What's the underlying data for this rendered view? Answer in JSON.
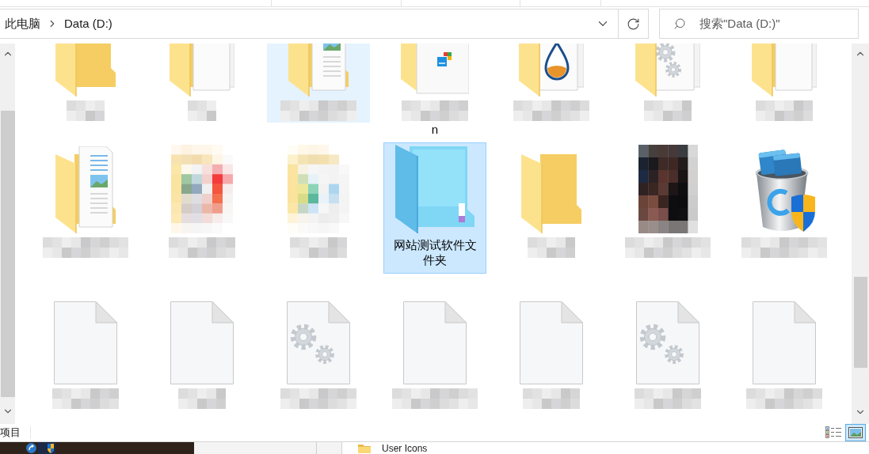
{
  "address_bar": {
    "breadcrumbs": [
      "此电脑",
      "Data (D:)"
    ]
  },
  "search": {
    "placeholder": "搜索\"Data (D:)\""
  },
  "files": [
    {
      "kind": "folder",
      "label_blurred": true,
      "selected": false,
      "hovered": false
    },
    {
      "kind": "folder-docs",
      "label_blurred": true,
      "selected": false,
      "hovered": false
    },
    {
      "kind": "folder-picture-doc",
      "label_blurred": true,
      "selected": false,
      "hovered": true
    },
    {
      "kind": "folder-logo-doc",
      "label_blurred": true,
      "label": "n",
      "selected": false,
      "hovered": false
    },
    {
      "kind": "folder-drop-doc",
      "label_blurred": true,
      "selected": false,
      "hovered": false
    },
    {
      "kind": "folder-gears",
      "label_blurred": true,
      "selected": false,
      "hovered": false
    },
    {
      "kind": "folder-docs",
      "label_blurred": true,
      "selected": false,
      "hovered": false
    },
    {
      "kind": "folder-picture-doc",
      "label_blurred": true,
      "selected": false,
      "hovered": false
    },
    {
      "kind": "mosaic-app",
      "label_blurred": true,
      "selected": false,
      "hovered": false
    },
    {
      "kind": "mosaic-app-alt",
      "label_blurred": true,
      "selected": false,
      "hovered": false
    },
    {
      "kind": "folder-blue",
      "label_blurred": false,
      "label": "网站测试软件文件夹",
      "selected": true,
      "hovered": false
    },
    {
      "kind": "folder",
      "label_blurred": true,
      "selected": false,
      "hovered": false
    },
    {
      "kind": "mosaic-photo",
      "label_blurred": true,
      "selected": false,
      "hovered": false
    },
    {
      "kind": "uninstaller",
      "label_blurred": true,
      "selected": false,
      "hovered": false
    },
    {
      "kind": "file",
      "label_blurred": true,
      "selected": false,
      "hovered": false
    },
    {
      "kind": "file",
      "label_blurred": true,
      "selected": false,
      "hovered": false
    },
    {
      "kind": "gear-file",
      "label_blurred": true,
      "selected": false,
      "hovered": false
    },
    {
      "kind": "file",
      "label_blurred": true,
      "selected": false,
      "hovered": false
    },
    {
      "kind": "file",
      "label_blurred": true,
      "selected": false,
      "hovered": false
    },
    {
      "kind": "gear-file",
      "label_blurred": true,
      "selected": false,
      "hovered": false
    },
    {
      "kind": "file",
      "label_blurred": true,
      "selected": false,
      "hovered": false
    }
  ],
  "status_bar": {
    "item_count": "项目",
    "views": [
      {
        "kind": "details",
        "selected": false
      },
      {
        "kind": "large-icons",
        "selected": true
      }
    ]
  },
  "background_window": {
    "folder": "User Icons"
  }
}
